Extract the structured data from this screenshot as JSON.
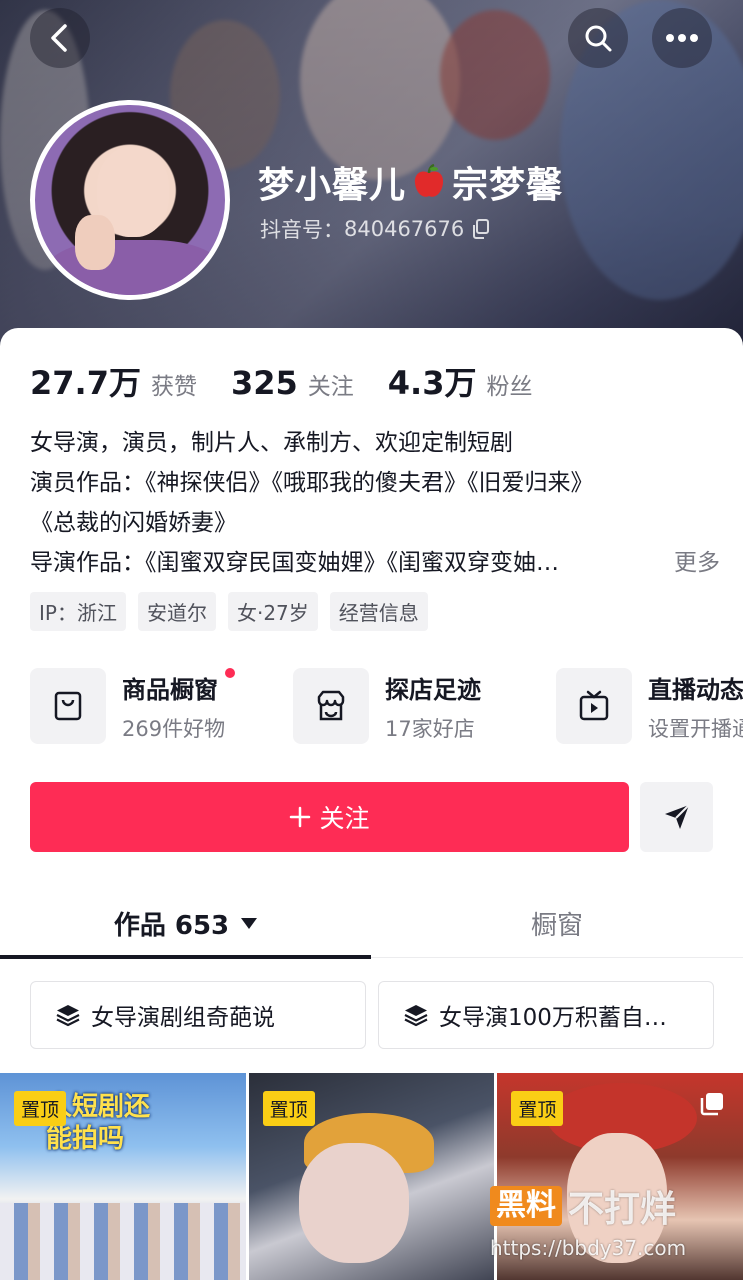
{
  "header": {
    "name": "梦小馨儿",
    "name_suffix": "宗梦馨",
    "douyin_id_label": "抖音号：",
    "douyin_id": "840467676"
  },
  "stats": [
    {
      "value": "27.7万",
      "label": "获赞"
    },
    {
      "value": "325",
      "label": "关注"
    },
    {
      "value": "4.3万",
      "label": "粉丝"
    }
  ],
  "bio": {
    "line1": "女导演，演员，制片人、承制方、欢迎定制短剧",
    "line2": "演员作品：《神探侠侣》《哦耶我的傻夫君》《旧爱归来》",
    "line3": "《总裁的闪婚娇妻》",
    "line4": "导演作品：《闺蜜双穿民国变妯娌》《闺蜜双穿变妯…",
    "more": "更多"
  },
  "tags": [
    "IP：浙江",
    "安道尔",
    "女·27岁",
    "经营信息"
  ],
  "features": [
    {
      "title": "商品橱窗",
      "subtitle": "269件好物",
      "icon": "bag-icon",
      "badge": true
    },
    {
      "title": "探店足迹",
      "subtitle": "17家好店",
      "icon": "store-icon",
      "badge": false
    },
    {
      "title": "直播动态",
      "subtitle": "设置开播通",
      "icon": "tv-icon",
      "badge": false
    }
  ],
  "actions": {
    "follow_label": "关注",
    "follow_color": "#fe2c55"
  },
  "tabs": {
    "works_label": "作品 653",
    "shop_label": "橱窗"
  },
  "collections": [
    "女导演剧组奇葩说",
    "女导演100万积蓄自…"
  ],
  "videos": [
    {
      "pin": "置顶",
      "text_line1": "人短剧还",
      "text_line2": "能拍吗"
    },
    {
      "pin": "置顶"
    },
    {
      "pin": "置顶"
    }
  ],
  "watermark": {
    "brand_box": "黑料",
    "brand_text": "不打烊",
    "url": "https://bbdy37.com"
  }
}
